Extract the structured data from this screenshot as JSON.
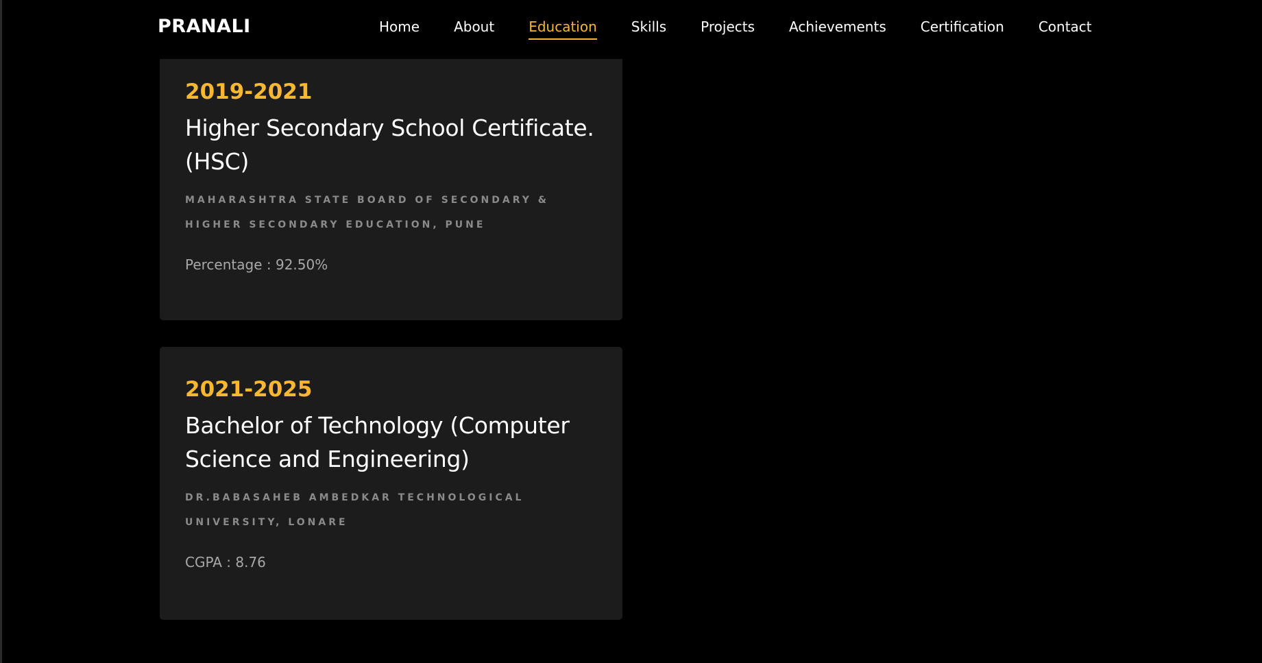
{
  "brand": "PRANALI",
  "nav": {
    "items": [
      "Home",
      "About",
      "Education",
      "Skills",
      "Projects",
      "Achievements",
      "Certification",
      "Contact"
    ],
    "active": "Education"
  },
  "education": [
    {
      "year": "2019-2021",
      "degree": "Higher Secondary School Certificate. (HSC)",
      "institution": "MAHARASHTRA STATE BOARD OF SECONDARY & HIGHER SECONDARY EDUCATION, PUNE",
      "score": "Percentage : 92.50%"
    },
    {
      "year": "2021-2025",
      "degree": "Bachelor of Technology (Computer Science and Engineering)",
      "institution": "DR.BABASAHEB AMBEDKAR TECHNOLOGICAL UNIVERSITY, LONARE",
      "score": "CGPA : 8.76"
    }
  ],
  "colors": {
    "accent": "#f7b731",
    "background": "#000000",
    "card": "#1c1c1c",
    "muted": "#8a8a8a"
  }
}
